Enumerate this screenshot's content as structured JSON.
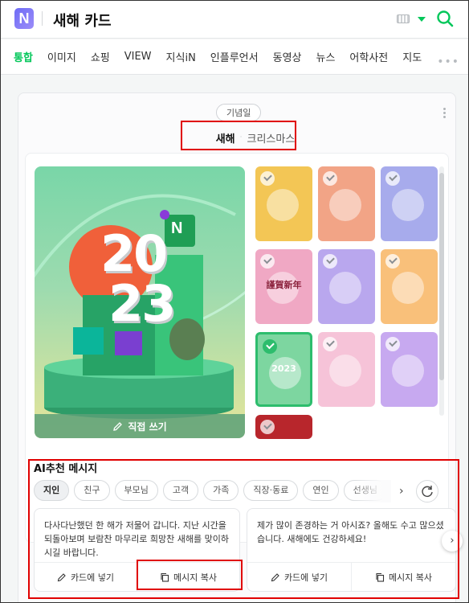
{
  "header": {
    "logo": "N",
    "query": "새해 카드"
  },
  "tabs": [
    "통합",
    "이미지",
    "쇼핑",
    "VIEW",
    "지식iN",
    "인플루언서",
    "동영상",
    "뉴스",
    "어학사전",
    "지도"
  ],
  "tab_more": "•••",
  "card_panel": {
    "category_chip": "기념일",
    "subtabs": {
      "active": "새해",
      "separator": "·",
      "other": "크리스마스"
    },
    "main_card": {
      "year_top": "20",
      "year_bottom": "23",
      "logo": "N",
      "write_label": "직접 쓰기"
    },
    "thumbnails": [
      {
        "name": "thumb-moon-coin",
        "bg": "#f3c655"
      },
      {
        "name": "thumb-lucky-bag",
        "bg": "#f2a486"
      },
      {
        "name": "thumb-mountain-crane",
        "bg": "#a7abec"
      },
      {
        "name": "thumb-new-year-book",
        "bg": "#f0a8c4",
        "text": "謹賀新年"
      },
      {
        "name": "thumb-sun-clouds",
        "bg": "#b9a7ee"
      },
      {
        "name": "thumb-house-rabbit",
        "bg": "#f9c07a"
      },
      {
        "name": "thumb-2023-green",
        "bg": "#7dd6a0",
        "text": "2023",
        "selected": true
      },
      {
        "name": "thumb-purple-gift",
        "bg": "#f6c3d8"
      },
      {
        "name": "thumb-pink-bag",
        "bg": "#c7a9f0"
      },
      {
        "name": "thumb-red-partial",
        "bg": "#b8262c"
      }
    ]
  },
  "ai_section": {
    "title": "AI추천 메시지",
    "chips": [
      "지인",
      "친구",
      "부모님",
      "고객",
      "가족",
      "직장·동료",
      "연인",
      "선생님"
    ],
    "messages": [
      {
        "text": "다사다난했던 한 해가 저물어 갑니다. 지난 시간을 되돌아보며 보람찬 마무리로 희망찬 새해를 맞이하시길 바랍니다.",
        "insert_label": "카드에 넣기",
        "copy_label": "메시지 복사"
      },
      {
        "text": "제가 많이 존경하는 거 아시죠? 올해도 수고 많으셨습니다. 새해에도 건강하세요!",
        "insert_label": "카드에 넣기",
        "copy_label": "메시지 복사"
      }
    ]
  },
  "colors": {
    "accent": "#03c75a",
    "highlight": "#e00000"
  }
}
